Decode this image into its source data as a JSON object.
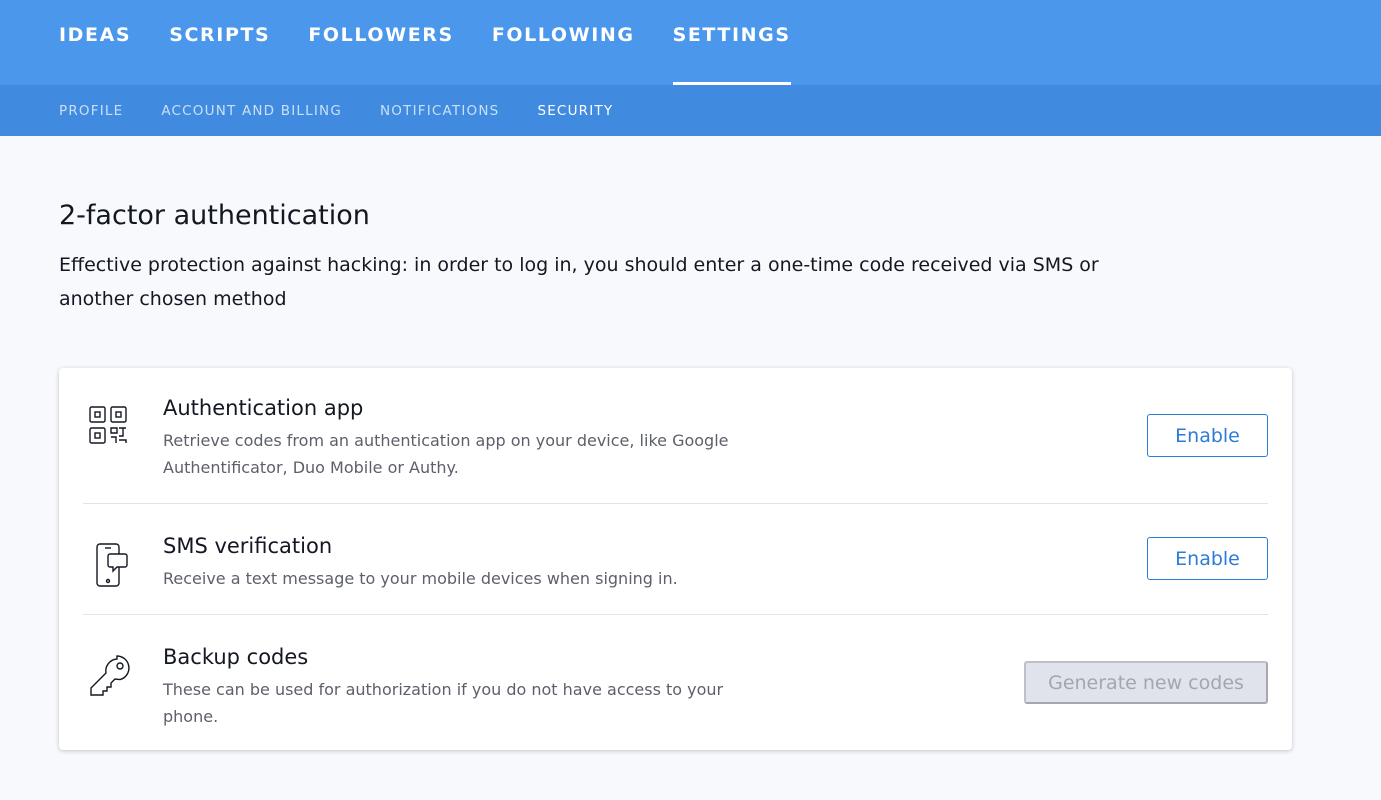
{
  "topnav": {
    "tabs": [
      {
        "label": "IDEAS"
      },
      {
        "label": "SCRIPTS"
      },
      {
        "label": "FOLLOWERS"
      },
      {
        "label": "FOLLOWING"
      },
      {
        "label": "SETTINGS"
      }
    ],
    "active": "SETTINGS"
  },
  "subnav": {
    "tabs": [
      {
        "label": "PROFILE"
      },
      {
        "label": "ACCOUNT AND BILLING"
      },
      {
        "label": "NOTIFICATIONS"
      },
      {
        "label": "SECURITY"
      }
    ],
    "active": "SECURITY"
  },
  "section": {
    "title": "2-factor authentication",
    "description": "Effective protection against hacking: in order to log in, you should enter a one-time code received via SMS or another chosen method"
  },
  "methods": [
    {
      "title": "Authentication app",
      "description": "Retrieve codes from an authentication app on your device, like Google Authentificator, Duo Mobile or Authy.",
      "button": "Enable",
      "icon": "qr-code-icon"
    },
    {
      "title": "SMS verification",
      "description": "Receive a text message to your mobile devices when signing in.",
      "button": "Enable",
      "icon": "phone-message-icon"
    },
    {
      "title": "Backup codes",
      "description": "These can be used for authorization if you do not have access to your phone.",
      "button": "Generate new codes",
      "icon": "key-icon"
    }
  ],
  "colors": {
    "topnav_bg": "#4a97eb",
    "subnav_bg": "#408be0",
    "accent": "#2e7bd6",
    "page_bg": "#f8f9fd"
  }
}
